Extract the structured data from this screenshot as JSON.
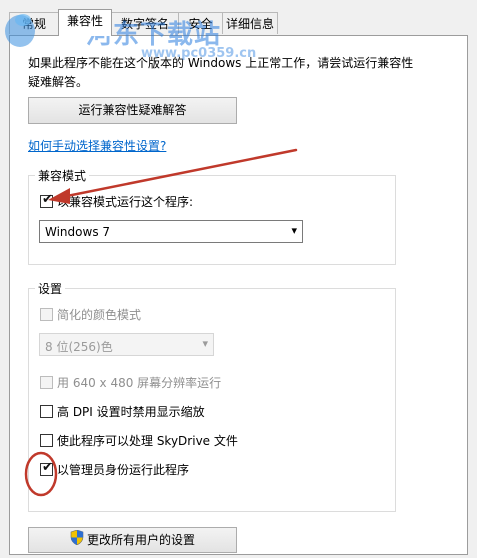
{
  "tabs": [
    "常规",
    "兼容性",
    "数字签名",
    "安全",
    "详细信息"
  ],
  "description": "如果此程序不能在这个版本的 Windows 上正常工作，请尝试运行兼容性疑难解答。",
  "troubleshoot_button": "运行兼容性疑难解答",
  "manual_link": "如何手动选择兼容性设置?",
  "compat_mode": {
    "legend": "兼容模式",
    "checkbox_label": "以兼容模式运行这个程序:",
    "checked": true,
    "selected_os": "Windows 7"
  },
  "settings": {
    "legend": "设置",
    "reduced_color": {
      "label": "简化的颜色模式",
      "checked": false,
      "enabled": false
    },
    "color_depth": "8 位(256)色",
    "resolution": {
      "label": "用 640 x 480 屏幕分辨率运行",
      "checked": false,
      "enabled": false
    },
    "dpi": {
      "label": "高 DPI 设置时禁用显示缩放",
      "checked": false,
      "enabled": true
    },
    "skydrive": {
      "label": "使此程序可以处理 SkyDrive 文件",
      "checked": false,
      "enabled": true
    },
    "run_as_admin": {
      "label": "以管理员身份运行此程序",
      "checked": true,
      "enabled": true
    }
  },
  "change_all_button": "更改所有用户的设置",
  "watermark": {
    "title": "河东下载站",
    "url": "www.pc0359.cn"
  },
  "colors": {
    "annotation_red": "#c0392b",
    "link_blue": "#0066cc"
  }
}
